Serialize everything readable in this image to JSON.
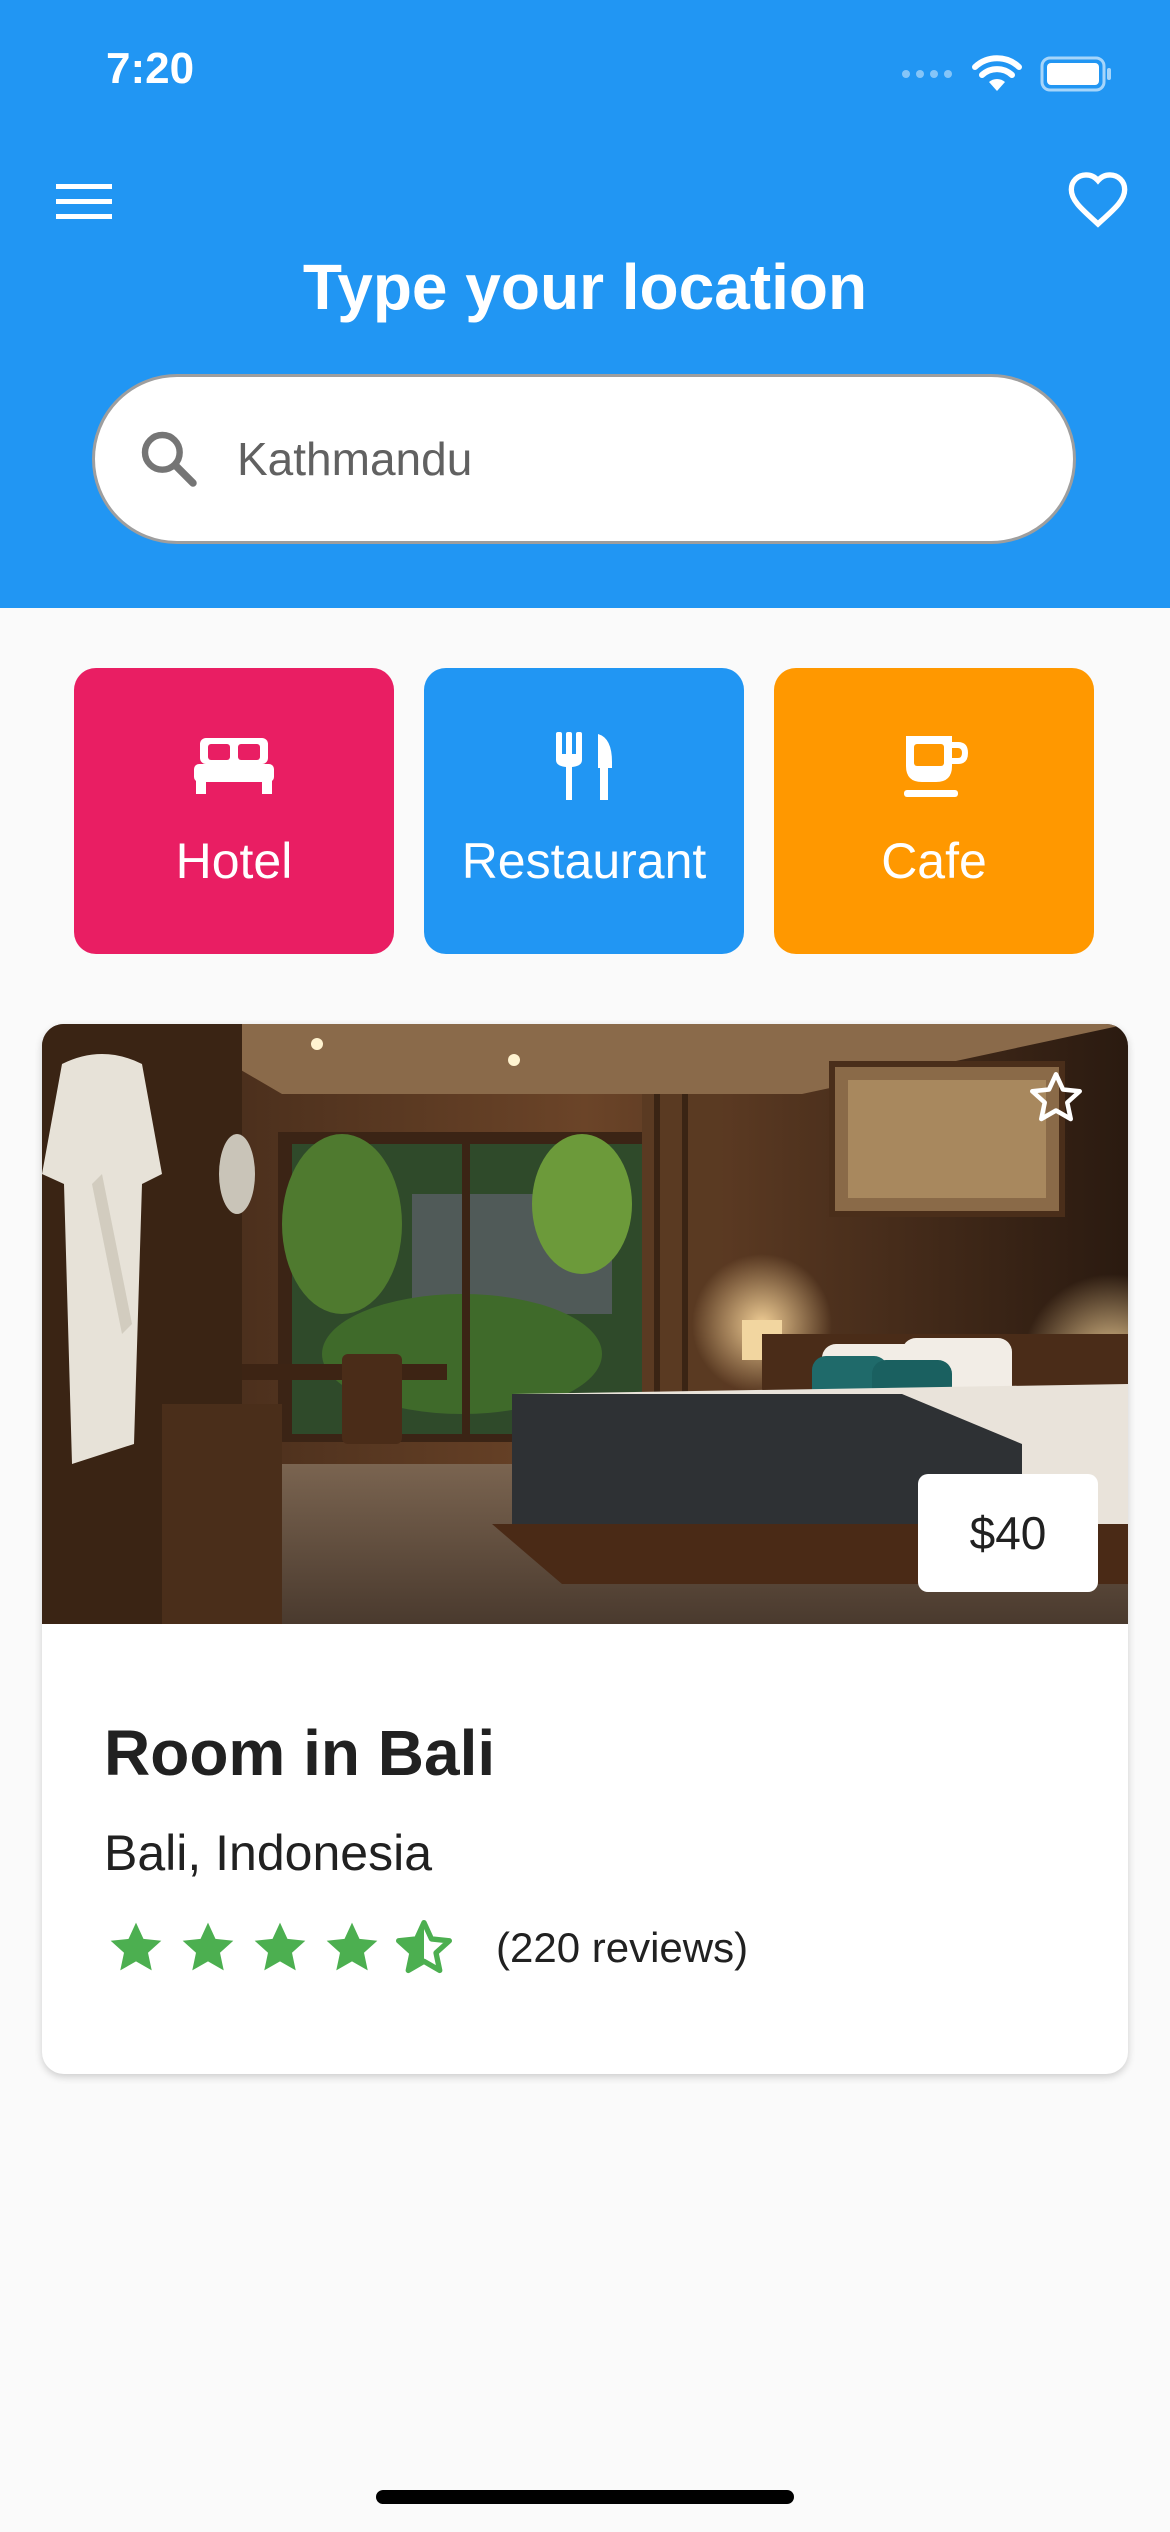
{
  "status_bar": {
    "time": "7:20",
    "icons": [
      "cellular-signal-icon",
      "wifi-icon",
      "battery-icon"
    ]
  },
  "header": {
    "menu_icon": "menu-icon",
    "favorite_icon": "heart-outline-icon",
    "title": "Type your location",
    "background_color": "#2196f3"
  },
  "search": {
    "icon": "search-icon",
    "value": "Kathmandu",
    "placeholder": ""
  },
  "categories": [
    {
      "label": "Hotel",
      "icon": "bed-icon",
      "color": "#e91e63"
    },
    {
      "label": "Restaurant",
      "icon": "fork-knife-icon",
      "color": "#2196f3"
    },
    {
      "label": "Cafe",
      "icon": "coffee-cup-icon",
      "color": "#ff9800"
    }
  ],
  "listing": {
    "image": "hotel-room-photo",
    "favorite_icon": "star-outline-icon",
    "price": "$40",
    "title": "Room in Bali",
    "location": "Bali, Indonesia",
    "rating": 4.5,
    "rating_max": 5,
    "rating_color": "#4caf50",
    "reviews": "(220 reviews)"
  }
}
